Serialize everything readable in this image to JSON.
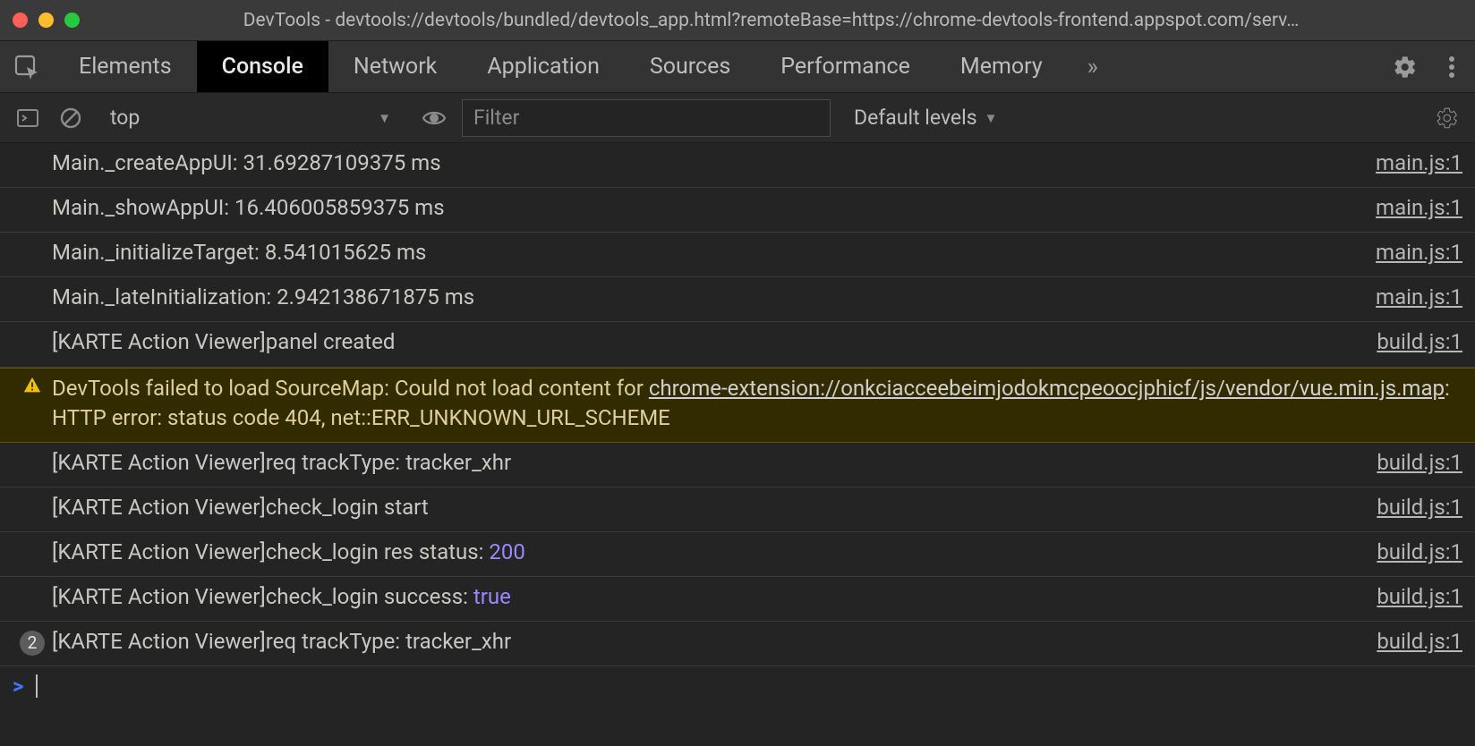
{
  "window": {
    "title": "DevTools - devtools://devtools/bundled/devtools_app.html?remoteBase=https://chrome-devtools-frontend.appspot.com/serv…"
  },
  "tabs": {
    "items": [
      "Elements",
      "Console",
      "Network",
      "Application",
      "Sources",
      "Performance",
      "Memory"
    ],
    "active": "Console",
    "more_glyph": "»"
  },
  "toolbar": {
    "context": "top",
    "filter_placeholder": "Filter",
    "levels_label": "Default levels"
  },
  "logs": [
    {
      "type": "log",
      "text": "Main._createAppUI: 31.69287109375 ms",
      "source": "main.js:1"
    },
    {
      "type": "log",
      "text": "Main._showAppUI: 16.406005859375 ms",
      "source": "main.js:1"
    },
    {
      "type": "log",
      "text": "Main._initializeTarget: 8.541015625 ms",
      "source": "main.js:1"
    },
    {
      "type": "log",
      "text": "Main._lateInitialization: 2.942138671875 ms",
      "source": "main.js:1"
    },
    {
      "type": "log",
      "text": "[KARTE Action Viewer]panel created",
      "source": "build.js:1"
    },
    {
      "type": "warning",
      "pre": "DevTools failed to load SourceMap: Could not load content for ",
      "url": "chrome-extension://onkciacceebeimjodokmcpeoocjphicf/js/vendor/vue.min.js.map",
      "post": ": HTTP error: status code 404, net::ERR_UNKNOWN_URL_SCHEME"
    },
    {
      "type": "log",
      "text": "[KARTE Action Viewer]req trackType:  tracker_xhr",
      "source": "build.js:1"
    },
    {
      "type": "log",
      "text": "[KARTE Action Viewer]check_login start",
      "source": "build.js:1"
    },
    {
      "type": "log-rich",
      "parts": [
        {
          "t": "[KARTE Action Viewer]check_login res status:  "
        },
        {
          "t": "200",
          "cls": "val-num"
        }
      ],
      "source": "build.js:1"
    },
    {
      "type": "log-rich",
      "parts": [
        {
          "t": "[KARTE Action Viewer]check_login success:  "
        },
        {
          "t": "true",
          "cls": "val-bool"
        }
      ],
      "source": "build.js:1"
    },
    {
      "type": "log",
      "count": 2,
      "text": "[KARTE Action Viewer]req trackType:  tracker_xhr",
      "source": "build.js:1"
    }
  ],
  "prompt": {
    "caret": ">"
  }
}
